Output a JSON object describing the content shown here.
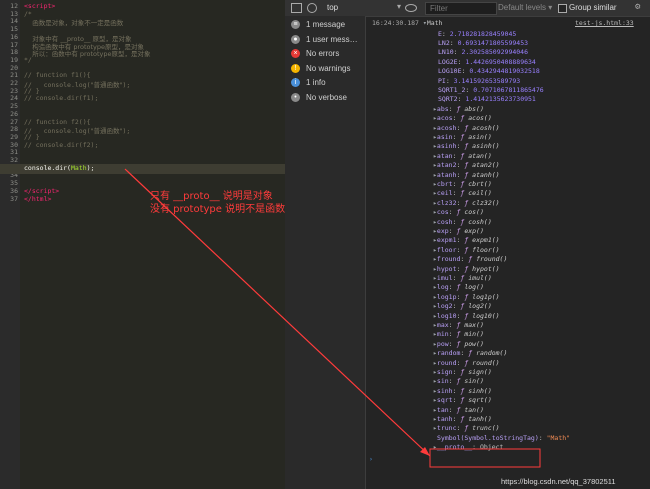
{
  "editor": {
    "lines": [
      {
        "n": "12",
        "html": "<span class='tag'>&lt;script&gt;</span>"
      },
      {
        "n": "13",
        "html": "<span class='cmt'>/*</span>"
      },
      {
        "n": "14",
        "html": "<span class='cmt zh'>    函数是对象，对象不一定是函数</span>"
      },
      {
        "n": "15",
        "html": ""
      },
      {
        "n": "16",
        "html": "<span class='cmt zh'>    对象中有 __proto__ 原型，是对象</span>"
      },
      {
        "n": "17",
        "html": "<span class='cmt zh'>    构造函数中有 prototype原型，是对象</span>"
      },
      {
        "n": "18",
        "html": "<span class='cmt zh'>    所以：函数中有 prototype原型，是对象</span>"
      },
      {
        "n": "19",
        "html": "<span class='cmt'>*/</span>"
      },
      {
        "n": "20",
        "html": ""
      },
      {
        "n": "21",
        "html": "<span class='cmt'>// function f1(){</span>"
      },
      {
        "n": "22",
        "html": "<span class='cmt'>//   console.log(<span class='zh'>\"普通函数\"</span>);</span>"
      },
      {
        "n": "23",
        "html": "<span class='cmt'>// }</span>"
      },
      {
        "n": "24",
        "html": "<span class='cmt'>// console.dir(f1);</span>"
      },
      {
        "n": "25",
        "html": ""
      },
      {
        "n": "26",
        "html": ""
      },
      {
        "n": "27",
        "html": "<span class='cmt'>// function f2(){</span>"
      },
      {
        "n": "28",
        "html": "<span class='cmt'>//   console.log(<span class='zh'>\"普通函数\"</span>);</span>"
      },
      {
        "n": "29",
        "html": "<span class='cmt'>// }</span>"
      },
      {
        "n": "30",
        "html": "<span class='cmt'>// console.dir(f2);</span>"
      },
      {
        "n": "31",
        "html": ""
      },
      {
        "n": "32",
        "html": ""
      },
      {
        "n": "33",
        "html": "console.dir(<span class='obj'>Math</span>);"
      },
      {
        "n": "34",
        "html": ""
      },
      {
        "n": "35",
        "html": ""
      },
      {
        "n": "36",
        "html": "<span class='tag'>&lt;/script&gt;</span>"
      },
      {
        "n": "37",
        "html": "<span class='tag'>&lt;/html&gt;</span>"
      }
    ],
    "annotation_line1": "只有 __proto__ 说明是对象",
    "annotation_line2": "没有 prototype 说明不是函数"
  },
  "toolbar": {
    "context": "top",
    "filter_placeholder": "Filter",
    "levels": "Default levels ▾",
    "group_similar": "Group similar"
  },
  "sidebar": {
    "items": [
      {
        "icon": "list-icon",
        "label": "1 message",
        "color": "#8a8a8a"
      },
      {
        "icon": "user-icon",
        "label": "1 user mess…",
        "color": "#8a8a8a"
      },
      {
        "icon": "error-icon",
        "label": "No errors",
        "color": "#e53935"
      },
      {
        "icon": "warning-icon",
        "label": "No warnings",
        "color": "#f4b400"
      },
      {
        "icon": "info-icon",
        "label": "1 info",
        "color": "#4a90d9"
      },
      {
        "icon": "verbose-icon",
        "label": "No verbose",
        "color": "#8a8a8a"
      }
    ]
  },
  "console": {
    "timestamp": "16:24:30.187",
    "object_name": "Math",
    "source_link": "test-js.html:33",
    "constants": [
      {
        "k": "E",
        "v": "2.718281828459045"
      },
      {
        "k": "LN2",
        "v": "0.6931471805599453"
      },
      {
        "k": "LN10",
        "v": "2.302585092994046"
      },
      {
        "k": "LOG2E",
        "v": "1.4426950408889634"
      },
      {
        "k": "LOG10E",
        "v": "0.4342944819032518"
      },
      {
        "k": "PI",
        "v": "3.141592653589793"
      },
      {
        "k": "SQRT1_2",
        "v": "0.7071067811865476"
      },
      {
        "k": "SQRT2",
        "v": "1.4142135623730951"
      }
    ],
    "methods": [
      "abs",
      "acos",
      "acosh",
      "asin",
      "asinh",
      "atan",
      "atan2",
      "atanh",
      "cbrt",
      "ceil",
      "clz32",
      "cos",
      "cosh",
      "exp",
      "expm1",
      "floor",
      "fround",
      "hypot",
      "imul",
      "log",
      "log1p",
      "log2",
      "log10",
      "max",
      "min",
      "pow",
      "random",
      "round",
      "sign",
      "sin",
      "sinh",
      "sqrt",
      "tan",
      "tanh",
      "trunc"
    ],
    "symbol_key": "Symbol(Symbol.toStringTag)",
    "symbol_value": "\"Math\"",
    "proto_key": "__proto__",
    "proto_value": "Object",
    "watermark": "https://blog.csdn.net/qq_37802511"
  }
}
